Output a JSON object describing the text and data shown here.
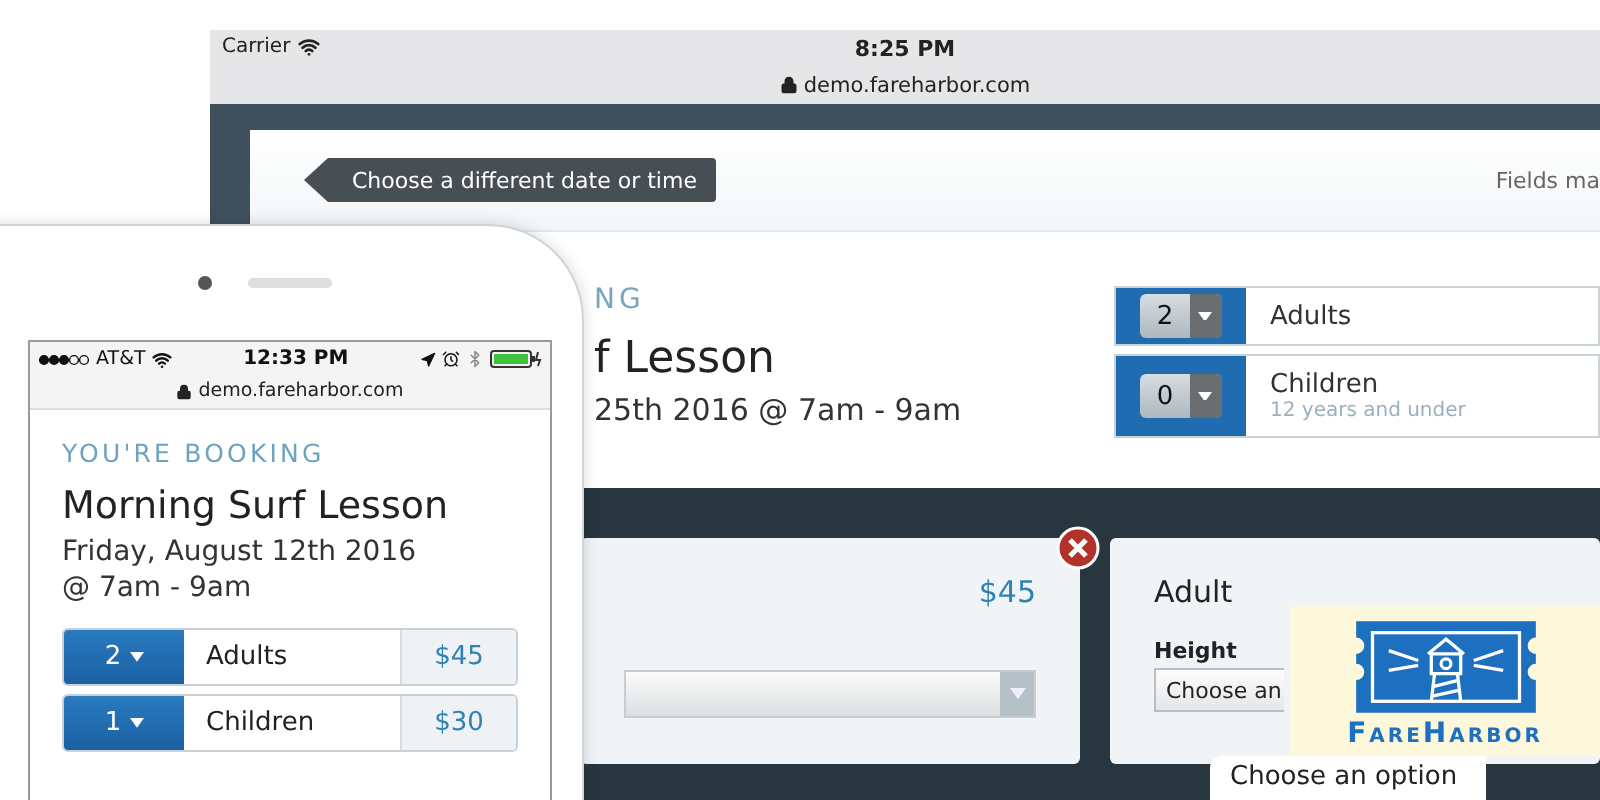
{
  "tablet": {
    "status_bar": {
      "carrier": "Carrier",
      "time": "8:25 PM",
      "url": "demo.fareharbor.com"
    },
    "back_button": "Choose a different date or time",
    "header_note": "Fields ma",
    "booking": {
      "eyebrow": "NG",
      "title": "f Lesson",
      "date": "25th 2016 @ 7am - 9am"
    },
    "guests": [
      {
        "count": "2",
        "label": "Adults"
      },
      {
        "count": "0",
        "label": "Children",
        "note": "12 years and under"
      }
    ],
    "cards": [
      {
        "kind": "price",
        "price": "$45"
      },
      {
        "kind": "form",
        "title": "Adult",
        "field_label": "Height",
        "value": "Choose an"
      }
    ],
    "dropdown": {
      "option": "Choose an option"
    }
  },
  "phone": {
    "status_bar": {
      "carrier": "AT&T",
      "time": "12:33 PM",
      "url": "demo.fareharbor.com"
    },
    "eyebrow": "YOU'RE BOOKING",
    "title": "Morning Surf Lesson",
    "date": "Friday, August 12th 2016",
    "time": "@ 7am - 9am",
    "guests": [
      {
        "count": "2",
        "label": "Adults",
        "price": "$45"
      },
      {
        "count": "1",
        "label": "Children",
        "price": "$30"
      }
    ]
  },
  "logo": {
    "text": "FareHarbor"
  }
}
